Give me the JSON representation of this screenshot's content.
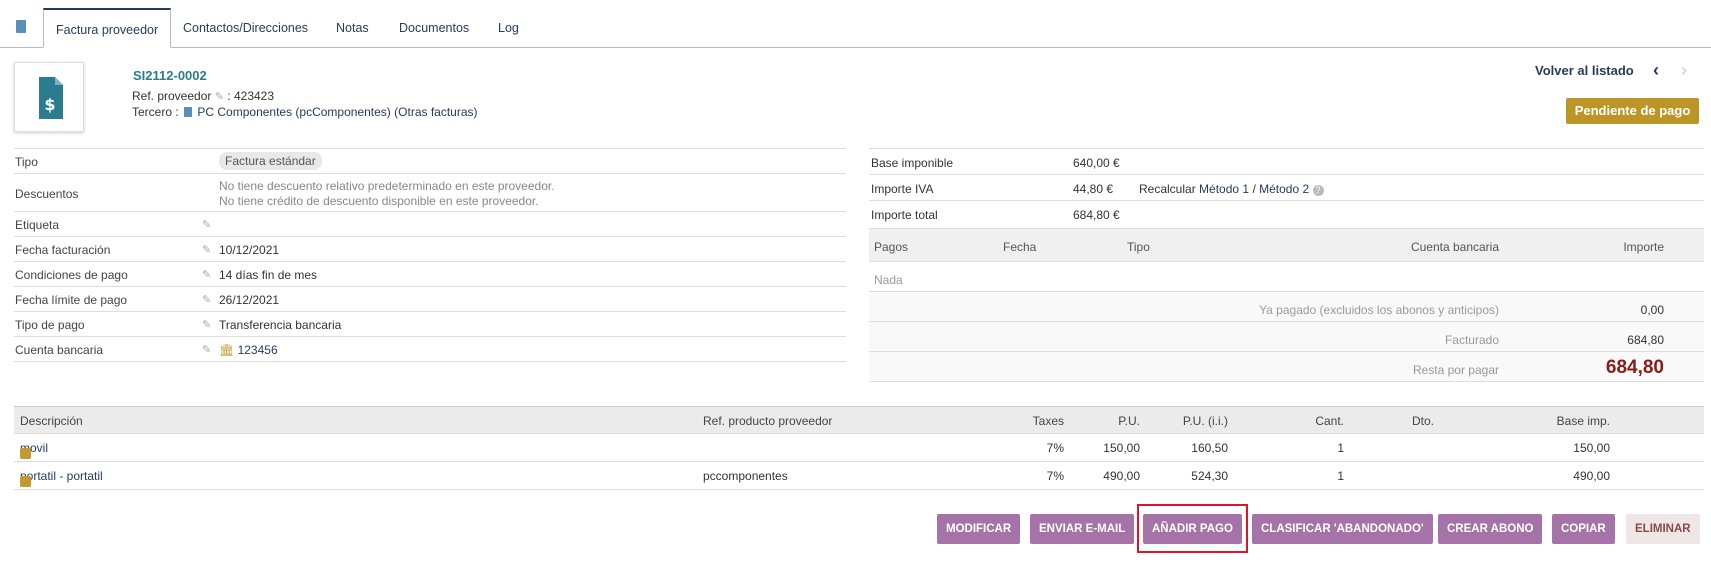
{
  "tabs": [
    {
      "label": "Factura proveedor"
    },
    {
      "label": "Contactos/Direcciones"
    },
    {
      "label": "Notas"
    },
    {
      "label": "Documentos"
    },
    {
      "label": "Log"
    }
  ],
  "header": {
    "ref": "SI2112-0002",
    "ref_prov_label": "Ref. proveedor",
    "ref_prov_value": ": 423423",
    "tercero_label": "Tercero :",
    "tercero_name": "PC Componentes (pcComponentes)",
    "otras_facturas": "(Otras facturas)",
    "back_label": "Volver al listado",
    "status": "Pendiente de pago"
  },
  "details": {
    "tipo": {
      "label": "Tipo",
      "value": "Factura estándar"
    },
    "descuentos": {
      "label": "Descuentos",
      "line1": "No tiene descuento relativo predeterminado en este proveedor.",
      "line2": "No tiene crédito de descuento disponible en este proveedor."
    },
    "etiqueta": {
      "label": "Etiqueta"
    },
    "fecha_facturacion": {
      "label": "Fecha facturación",
      "value": "10/12/2021"
    },
    "condiciones_pago": {
      "label": "Condiciones de pago",
      "value": "14 días fin de mes"
    },
    "fecha_limite": {
      "label": "Fecha límite de pago",
      "value": "26/12/2021"
    },
    "tipo_pago": {
      "label": "Tipo de pago",
      "value": "Transferencia bancaria"
    },
    "cuenta_bancaria": {
      "label": "Cuenta bancaria",
      "value": "123456"
    }
  },
  "amounts": {
    "base": {
      "label": "Base imponible",
      "value": "640,00 €"
    },
    "iva": {
      "label": "Importe IVA",
      "value": "44,80 €",
      "recalc": "Recalcular",
      "metodo1": "Método 1",
      "sep": "/",
      "metodo2": "Método 2"
    },
    "total": {
      "label": "Importe total",
      "value": "684,80 €"
    }
  },
  "payments": {
    "headers": {
      "pagos": "Pagos",
      "fecha": "Fecha",
      "tipo": "Tipo",
      "cuenta": "Cuenta bancaria",
      "importe": "Importe"
    },
    "empty": "Nada",
    "ya_pagado": {
      "label": "Ya pagado (excluidos los abonos y anticipos)",
      "value": "0,00"
    },
    "facturado": {
      "label": "Facturado",
      "value": "684,80"
    },
    "resta": {
      "label": "Resta por pagar",
      "value": "684,80"
    }
  },
  "lines": {
    "headers": {
      "desc": "Descripción",
      "ref": "Ref. producto proveedor",
      "taxes": "Taxes",
      "pu": "P.U.",
      "pu_ii": "P.U. (i.i.)",
      "cant": "Cant.",
      "dto": "Dto.",
      "base": "Base imp."
    },
    "rows": [
      {
        "desc": "movil",
        "ref": "",
        "taxes": "7%",
        "pu": "150,00",
        "pu_ii": "160,50",
        "cant": "1",
        "base": "150,00"
      },
      {
        "desc": "portatil - portatil",
        "ref": "pccomponentes",
        "taxes": "7%",
        "pu": "490,00",
        "pu_ii": "524,30",
        "cant": "1",
        "base": "490,00"
      }
    ]
  },
  "actions": {
    "modificar": "MODIFICAR",
    "enviar": "ENVIAR E-MAIL",
    "anadir_pago": "AÑADIR PAGO",
    "clasificar": "CLASIFICAR 'ABANDONADO'",
    "crear_abono": "CREAR ABONO",
    "copiar": "COPIAR",
    "eliminar": "ELIMINAR"
  },
  "colors": {
    "accent": "#a673a8",
    "status": "#bc9526",
    "danger_text": "#8b1a1a",
    "highlight": "#e0132b"
  }
}
